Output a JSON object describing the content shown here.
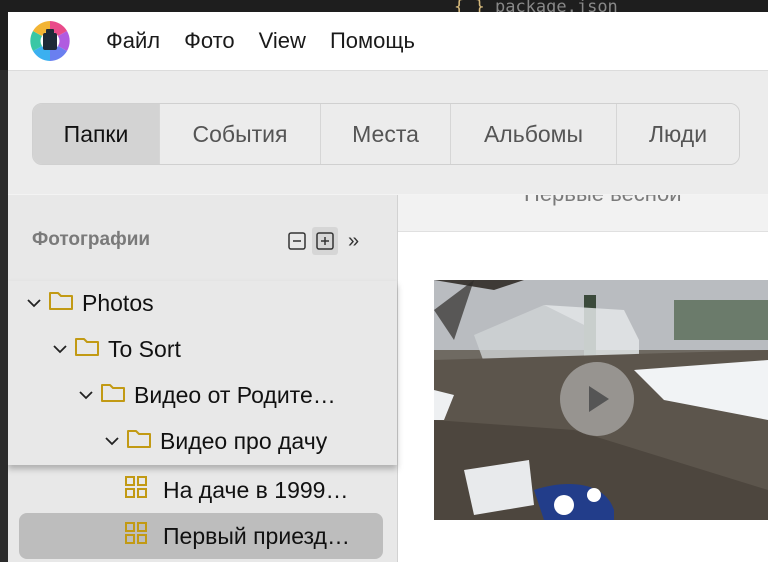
{
  "background": {
    "behind_text": "package.json",
    "behind_brace": "{ }"
  },
  "menu": {
    "items": [
      "Файл",
      "Фото",
      "View",
      "Помощь"
    ]
  },
  "tabs": [
    {
      "label": "Папки",
      "active": true
    },
    {
      "label": "События",
      "active": false
    },
    {
      "label": "Места",
      "active": false
    },
    {
      "label": "Альбомы",
      "active": false
    },
    {
      "label": "Люди",
      "active": false
    }
  ],
  "sidebar": {
    "header": "Фотографии",
    "collapse_icon": "collapse-all-icon",
    "expand_icon": "expand-all-icon",
    "more_icon": "double-chevron-right-icon"
  },
  "tree": [
    {
      "label": "Photos",
      "depth": 0,
      "expanded": true,
      "icon": "folder-icon"
    },
    {
      "label": "To Sort",
      "depth": 1,
      "expanded": true,
      "icon": "folder-icon"
    },
    {
      "label": "Видео от Родите…",
      "depth": 2,
      "expanded": true,
      "icon": "folder-icon"
    },
    {
      "label": "Видео про дачу",
      "depth": 3,
      "expanded": true,
      "icon": "folder-icon"
    }
  ],
  "albums": [
    {
      "label": "На даче в 1999…",
      "icon": "grid-icon",
      "selected": false
    },
    {
      "label": "Первый приезд…",
      "icon": "grid-icon",
      "selected": true
    }
  ],
  "content": {
    "partial_heading": "Первые весной",
    "thumbnail": {
      "type": "video",
      "icon": "play-icon"
    }
  },
  "colors": {
    "folder": "#c29a14",
    "selected_row": "#bdbdbd",
    "active_tab": "#d3d3d3"
  }
}
